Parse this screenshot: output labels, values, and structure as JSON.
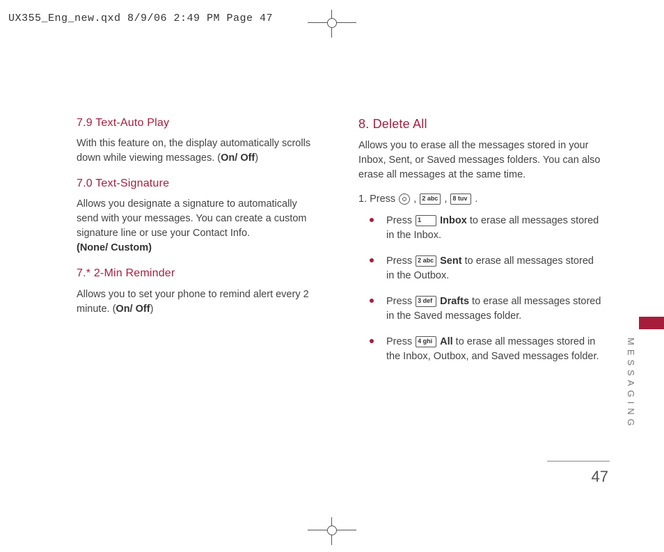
{
  "header": "UX355_Eng_new.qxd  8/9/06  2:49 PM  Page 47",
  "left": {
    "h1": "7.9 Text-Auto Play",
    "p1a": "With this feature on, the display automatically scrolls down while viewing messages. (",
    "p1b": "On/ Off",
    "p1c": ")",
    "h2": "7.0 Text-Signature",
    "p2a": "Allows you designate a signature to automatically send with your messages. You can create a custom signature line or use your Contact Info.",
    "p2b": "(None/ Custom)",
    "h3": "7.* 2-Min Reminder",
    "p3a": "Allows you to set your phone to remind alert every 2 minute. (",
    "p3b": "On/ Off",
    "p3c": ")"
  },
  "right": {
    "h1": "8. Delete All",
    "intro": "Allows you to erase all the messages stored in your Inbox, Sent, or Saved messages folders. You can also erase all messages at the same time.",
    "step_prefix": "1. Press ",
    "keyA": "2 abc",
    "keyB": "8 tuv",
    "bullets": [
      {
        "press": "Press ",
        "key": "1",
        "keylbl": "",
        "bold": "Inbox",
        "rest": " to erase all messages stored in the Inbox."
      },
      {
        "press": "Press ",
        "key": "2 abc",
        "bold": "Sent",
        "rest": " to erase all messages stored in the Outbox."
      },
      {
        "press": "Press ",
        "key": "3 def",
        "bold": "Drafts",
        "rest": " to erase all messages stored in the Saved messages folder."
      },
      {
        "press": "Press ",
        "key": "4 ghi",
        "bold": "All",
        "rest": " to erase all messages stored in the Inbox, Outbox, and Saved messages folder."
      }
    ]
  },
  "side_label": "MESSAGING",
  "page_number": "47"
}
